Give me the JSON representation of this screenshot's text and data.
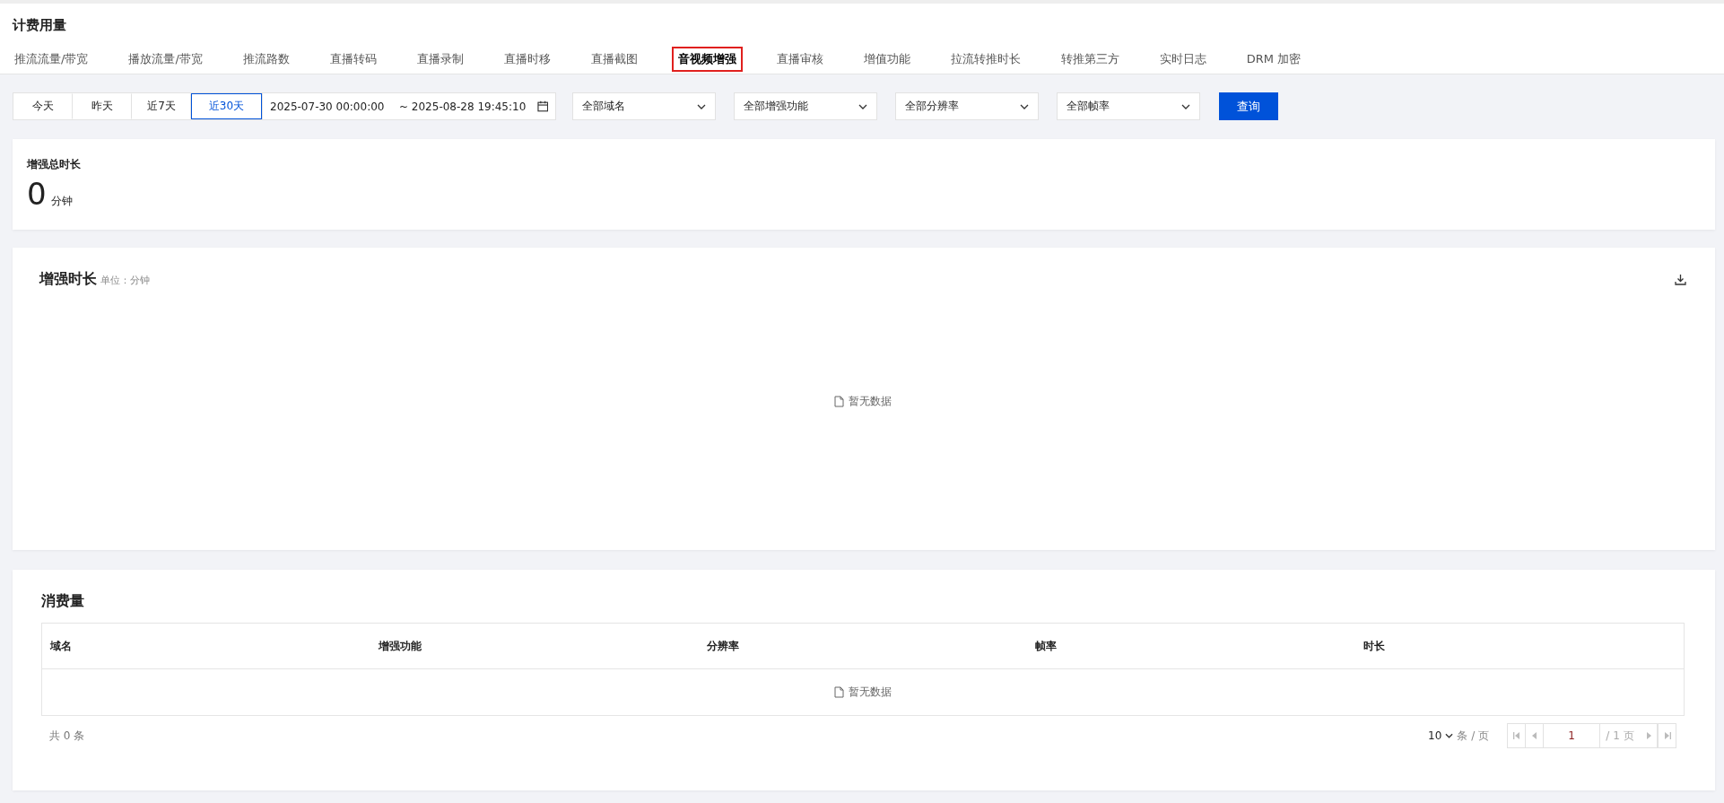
{
  "page_title": "计费用量",
  "tabs": [
    {
      "label": "推流流量/带宽",
      "selected": false
    },
    {
      "label": "播放流量/带宽",
      "selected": false
    },
    {
      "label": "推流路数",
      "selected": false
    },
    {
      "label": "直播转码",
      "selected": false
    },
    {
      "label": "直播录制",
      "selected": false
    },
    {
      "label": "直播时移",
      "selected": false
    },
    {
      "label": "直播截图",
      "selected": false
    },
    {
      "label": "音视频增强",
      "selected": true
    },
    {
      "label": "直播审核",
      "selected": false
    },
    {
      "label": "增值功能",
      "selected": false
    },
    {
      "label": "拉流转推时长",
      "selected": false
    },
    {
      "label": "转推第三方",
      "selected": false
    },
    {
      "label": "实时日志",
      "selected": false
    },
    {
      "label": "DRM 加密",
      "selected": false
    }
  ],
  "filters": {
    "ranges": [
      {
        "label": "今天",
        "selected": false
      },
      {
        "label": "昨天",
        "selected": false
      },
      {
        "label": "近7天",
        "selected": false
      },
      {
        "label": "近30天",
        "selected": true
      }
    ],
    "date_start": "2025-07-30 00:00:00",
    "date_end": "~ 2025-08-28 19:45:10",
    "selects": [
      "全部域名",
      "全部增强功能",
      "全部分辨率",
      "全部帧率"
    ],
    "query_button": "查询"
  },
  "summary": {
    "label": "增强总时长",
    "value": "0",
    "unit": "分钟"
  },
  "chart_panel": {
    "title": "增强时长",
    "unit": "单位：分钟",
    "empty": "暂无数据"
  },
  "table_panel": {
    "title": "消费量",
    "columns": [
      "域名",
      "增强功能",
      "分辨率",
      "帧率",
      "时长"
    ],
    "empty": "暂无数据",
    "total": "共 0 条",
    "page_size": "10",
    "page_size_unit": "条 / 页",
    "page": "1",
    "page_total": "/ 1 页"
  }
}
